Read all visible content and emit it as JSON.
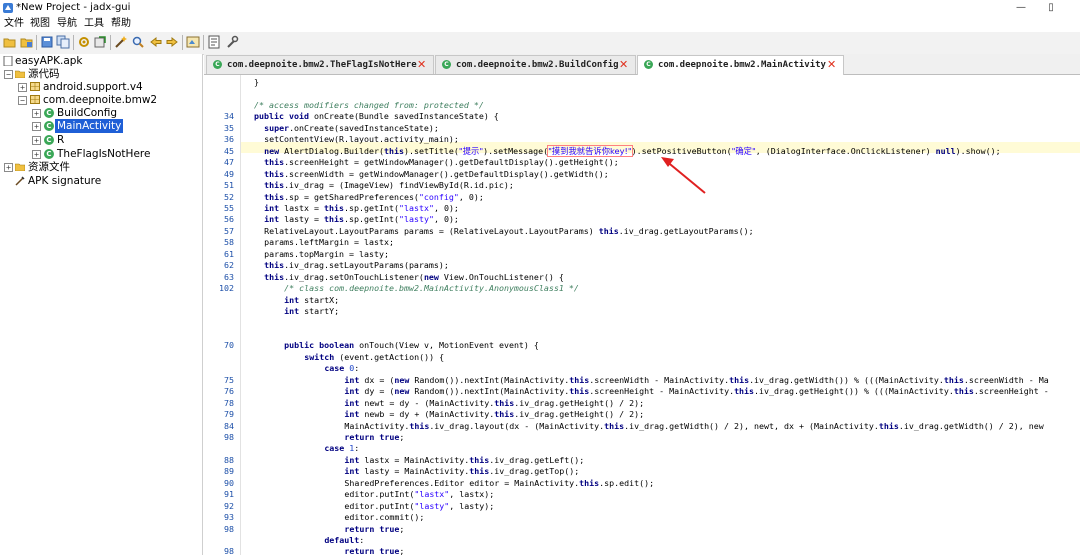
{
  "window": {
    "title": "*New Project - jadx-gui",
    "minimize_glyph": "—",
    "maximize_glyph": "▯"
  },
  "menu": [
    "文件",
    "视图",
    "导航",
    "工具",
    "帮助"
  ],
  "toolbar_icons": [
    "open-folder-icon",
    "save-icon",
    "save-all-icon",
    "copy-icon",
    "gear-icon",
    "export-icon",
    "wand-icon",
    "search-icon",
    "back-icon",
    "forward-icon",
    "home-icon",
    "log-icon",
    "wrench-icon"
  ],
  "tree": {
    "root": "easyAPK.apk",
    "source_node": "源代码",
    "packages": [
      "android.support.v4",
      "com.deepnoite.bmw2"
    ],
    "classes": [
      "BuildConfig",
      "MainActivity",
      "R",
      "TheFlagIsNotHere"
    ],
    "resources_node": "资源文件",
    "signature_node": "APK signature",
    "expand_plus": "+",
    "expand_minus": "−",
    "class_badge": "C"
  },
  "tabs": [
    {
      "label": "com.deepnoite.bmw2.TheFlagIsNotHere",
      "close": "✕"
    },
    {
      "label": "com.deepnoite.bmw2.BuildConfig",
      "close": "✕"
    },
    {
      "label": "com.deepnoite.bmw2.MainActivity",
      "close": "✕",
      "active": true
    }
  ],
  "code": {
    "line_numbers": [
      "",
      "",
      "",
      "34",
      "35",
      "36",
      "45",
      "47",
      "49",
      "51",
      "52",
      "55",
      "56",
      "57",
      "58",
      "61",
      "62",
      "63",
      "102",
      "",
      "",
      "",
      "",
      "70",
      "",
      "",
      "75",
      "76",
      "78",
      "79",
      "84",
      "98",
      "",
      "88",
      "89",
      "90",
      "91",
      "92",
      "93",
      "98",
      "",
      "98",
      ""
    ],
    "highlight_line": "45",
    "brace_close": "}",
    "annot_comment": "/* access modifiers changed from: protected */",
    "l34": {
      "kw1": "public void",
      "rest": " onCreate(Bundle savedInstanceState) {"
    },
    "l35": {
      "kw": "super",
      "rest": ".onCreate(savedInstanceState);"
    },
    "l36": "setContentView(R.layout.activity_main);",
    "l45": {
      "kw_new": "new",
      "p1": " AlertDialog.Builder(",
      "kw_this": "this",
      "p2": ").setTitle(",
      "s1": "\"提示\"",
      "p3": ").setMessage(",
      "s2": "\"摸到我就告诉你key!\"",
      "p4": ").setPositiveButton(",
      "s3": "\"确定\"",
      "p5": ", (DialogInterface.OnClickListener) ",
      "kw_null": "null",
      "p6": ").show();"
    },
    "l47": {
      "kw": "this",
      "rest": ".screenHeight = getWindowManager().getDefaultDisplay().getHeight();"
    },
    "l49": {
      "kw": "this",
      "rest": ".screenWidth = getWindowManager().getDefaultDisplay().getWidth();"
    },
    "l51": {
      "kw": "this",
      "rest": ".iv_drag = (ImageView) findViewById(R.id.pic);"
    },
    "l52": {
      "kw": "this",
      "rest1": ".sp = getSharedPreferences(",
      "str": "\"config\"",
      "rest2": ", 0);"
    },
    "l55": {
      "kw": "int",
      "rest1": " lastx = ",
      "kw2": "this",
      "rest2": ".sp.getInt(",
      "str": "\"lastx\"",
      "rest3": ", 0);"
    },
    "l56": {
      "kw": "int",
      "rest1": " lasty = ",
      "kw2": "this",
      "rest2": ".sp.getInt(",
      "str": "\"lasty\"",
      "rest3": ", 0);"
    },
    "l57": {
      "p1": "RelativeLayout.LayoutParams params = (RelativeLayout.LayoutParams) ",
      "kw": "this",
      "p2": ".iv_drag.getLayoutParams();"
    },
    "l58": "params.leftMargin = lastx;",
    "l61": "params.topMargin = lasty;",
    "l62": {
      "kw": "this",
      "rest": ".iv_drag.setLayoutParams(params);"
    },
    "l63": {
      "kw": "this",
      "p1": ".iv_drag.setOnTouchListener(",
      "kw2": "new",
      "p2": " View.OnTouchListener() {"
    },
    "anon_comment": "/* class com.deepnoite.bmw2.MainActivity.AnonymousClass1 */",
    "f1": {
      "kw": "int",
      "rest": " startX;"
    },
    "f2": {
      "kw": "int",
      "rest": " startY;"
    },
    "l70": {
      "kw": "public boolean",
      "rest": " onTouch(View v, MotionEvent event) {"
    },
    "sw": {
      "kw": "switch",
      "rest": " (event.getAction()) {"
    },
    "case0": {
      "kw": "case",
      "num": " 0",
      "rest": ":"
    },
    "l75": {
      "kw": "int",
      "p1": " dx = (",
      "kw2": "new",
      "p2": " Random()).nextInt(MainActivity.",
      "kw3": "this",
      "p3": ".screenWidth - MainActivity.",
      "kw4": "this",
      "p4": ".iv_drag.getWidth()) % (((MainActivity.",
      "kw5": "this",
      "p5": ".screenWidth - Ma"
    },
    "l76": {
      "kw": "int",
      "p1": " dy = (",
      "kw2": "new",
      "p2": " Random()).nextInt(MainActivity.",
      "kw3": "this",
      "p3": ".screenHeight - MainActivity.",
      "kw4": "this",
      "p4": ".iv_drag.getHeight()) % (((MainActivity.",
      "kw5": "this",
      "p5": ".screenHeight -"
    },
    "l78": {
      "kw": "int",
      "p1": " newt = dy - (MainActivity.",
      "kw2": "this",
      "p2": ".iv_drag.getHeight() / 2);"
    },
    "l79": {
      "kw": "int",
      "p1": " newb = dy + (MainActivity.",
      "kw2": "this",
      "p2": ".iv_drag.getHeight() / 2);"
    },
    "l84": {
      "p1": "MainActivity.",
      "kw": "this",
      "p2": ".iv_drag.layout(dx - (MainActivity.",
      "kw2": "this",
      "p3": ".iv_drag.getWidth() / 2), newt, dx + (MainActivity.",
      "kw3": "this",
      "p4": ".iv_drag.getWidth() / 2), new"
    },
    "ret1": {
      "kw": "return true",
      "rest": ";"
    },
    "case1": {
      "kw": "case",
      "num": " 1",
      "rest": ":"
    },
    "l88": {
      "kw": "int",
      "p1": " lastx = MainActivity.",
      "kw2": "this",
      "p2": ".iv_drag.getLeft();"
    },
    "l89": {
      "kw": "int",
      "p1": " lasty = MainActivity.",
      "kw2": "this",
      "p2": ".iv_drag.getTop();"
    },
    "l90": {
      "p1": "SharedPreferences.Editor editor = MainActivity.",
      "kw": "this",
      "p2": ".sp.edit();"
    },
    "l91": {
      "p1": "editor.putInt(",
      "str": "\"lastx\"",
      "p2": ", lastx);"
    },
    "l92": {
      "p1": "editor.putInt(",
      "str": "\"lasty\"",
      "p2": ", lasty);"
    },
    "l93": "editor.commit();",
    "ret2": {
      "kw": "return true",
      "rest": ";"
    },
    "def": {
      "kw": "default",
      "rest": ":"
    },
    "ret3": {
      "kw": "return true",
      "rest": ";"
    }
  },
  "colors": {
    "selection": "#1f5fd6",
    "highlight_line": "#fffbd6",
    "arrow": "#e02020",
    "keyword": "#000080",
    "string": "#2a00ff",
    "comment": "#3f7f5f",
    "line_number": "#1c4fa8"
  }
}
